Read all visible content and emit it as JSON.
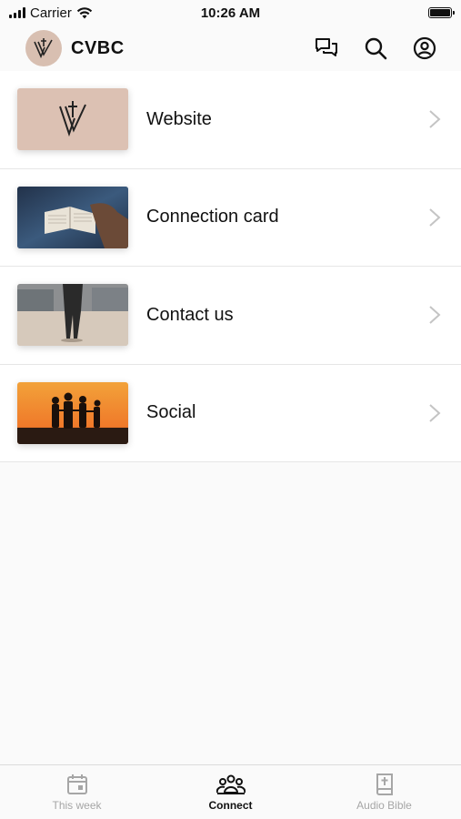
{
  "status_bar": {
    "carrier": "Carrier",
    "time": "10:26 AM",
    "icons": [
      "signal-icon",
      "wifi-icon",
      "battery-icon"
    ]
  },
  "header": {
    "brand": "CVBC",
    "logo_color": "#d8bfb1",
    "actions": [
      "chat-icon",
      "search-icon",
      "profile-icon"
    ]
  },
  "menu": {
    "items": [
      {
        "label": "Website",
        "thumb": "logo-thumbnail"
      },
      {
        "label": "Connection card",
        "thumb": "bible-photo"
      },
      {
        "label": "Contact us",
        "thumb": "person-standing-photo"
      },
      {
        "label": "Social",
        "thumb": "sunset-family-photo"
      }
    ]
  },
  "tab_bar": {
    "tabs": [
      {
        "label": "This week",
        "icon": "calendar-icon",
        "active": false
      },
      {
        "label": "Connect",
        "icon": "people-icon",
        "active": true
      },
      {
        "label": "Audio Bible",
        "icon": "bible-icon",
        "active": false
      }
    ],
    "active_color": "#111111",
    "inactive_color": "#a6a6a6"
  }
}
